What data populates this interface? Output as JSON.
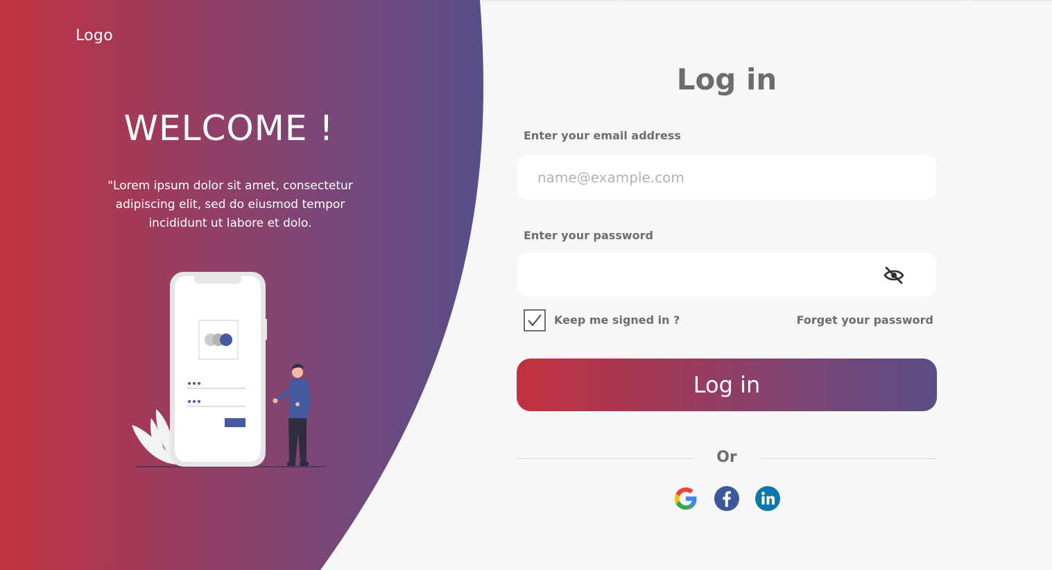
{
  "colors": {
    "gradient_start": "#c2323f",
    "gradient_end": "#594e87",
    "text_gray": "#6d6d6d",
    "background": "#f7f7f7",
    "placeholder": "#b3b3b3"
  },
  "brand": {
    "logo_text": "Logo"
  },
  "hero": {
    "heading": "WELCOME !",
    "description": "\"Lorem ipsum dolor sit amet, consectetur adipiscing elit, sed do eiusmod tempor incididunt ut labore et dolo."
  },
  "form": {
    "title": "Log in",
    "email": {
      "label": "Enter your email address",
      "placeholder": "name@example.com",
      "value": ""
    },
    "password": {
      "label": "Enter your password",
      "value": "",
      "toggle_icon": "eye-slash-icon"
    },
    "remember": {
      "label": "Keep me signed in ?",
      "checked": true
    },
    "forgot_link": "Forget your password",
    "submit_label": "Log in",
    "divider_text": "Or",
    "social": [
      {
        "name": "Google",
        "icon": "google-icon"
      },
      {
        "name": "Facebook",
        "icon": "facebook-icon"
      },
      {
        "name": "LinkedIn",
        "icon": "linkedin-icon"
      }
    ]
  }
}
